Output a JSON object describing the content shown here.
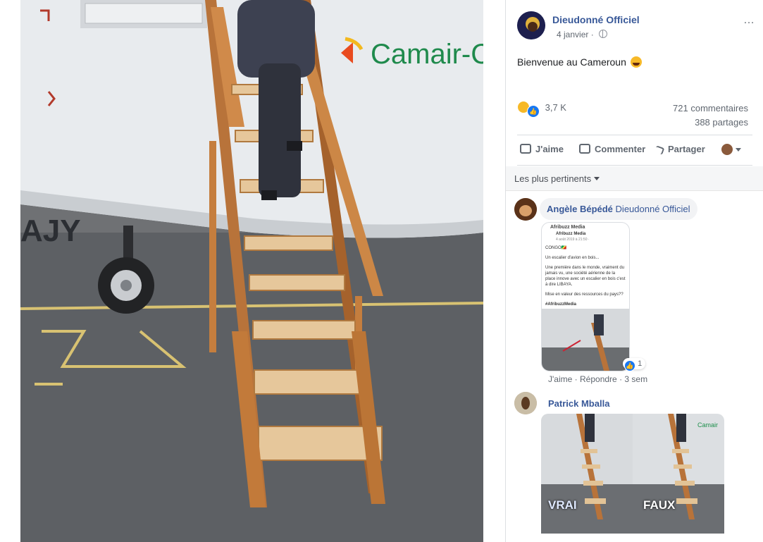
{
  "post": {
    "author": "Dieudonné Officiel",
    "date": "4 janvier",
    "more_icon": "…",
    "text": "Bienvenue au Cameroun",
    "reaction_count": "3,7 K",
    "comments_count": "721 commentaires",
    "shares_count": "388 partages"
  },
  "photo": {
    "airline_text": "Camair-Co",
    "registration_text": "AJY"
  },
  "actions": {
    "like": "J'aime",
    "comment": "Commenter",
    "share": "Partager"
  },
  "sort": {
    "label": "Les plus pertinents"
  },
  "comments": [
    {
      "author": "Angèle Bépédé",
      "mention": "Dieudonné Officiel",
      "attached": {
        "source": "Afribuzz Media",
        "page": "Afribuzz Media",
        "date_line": "4 août 2019 à 21:50 ·",
        "line1": "CONGO🇨🇬",
        "line2": "Un escalier d'avion en bois...",
        "line3": "Une première dans le monde, vraiment du jamais vu, une société aérienne de la place innove avec un escalier en bois c'est à dire LIBAYA.",
        "line4": "Mise en valeur des ressources du pays??",
        "line5": "#AfribuzzMedia"
      },
      "like_count": "1",
      "like_link": "J'aime",
      "reply_link": "Répondre",
      "age": "3 sem"
    },
    {
      "author": "Patrick Mballa",
      "image": {
        "left_label": "VRAI",
        "right_label": "FAUX",
        "brand": "Camair"
      }
    }
  ],
  "colors": {
    "link": "#385898",
    "secondary": "#606770",
    "like": "#1877f2"
  }
}
